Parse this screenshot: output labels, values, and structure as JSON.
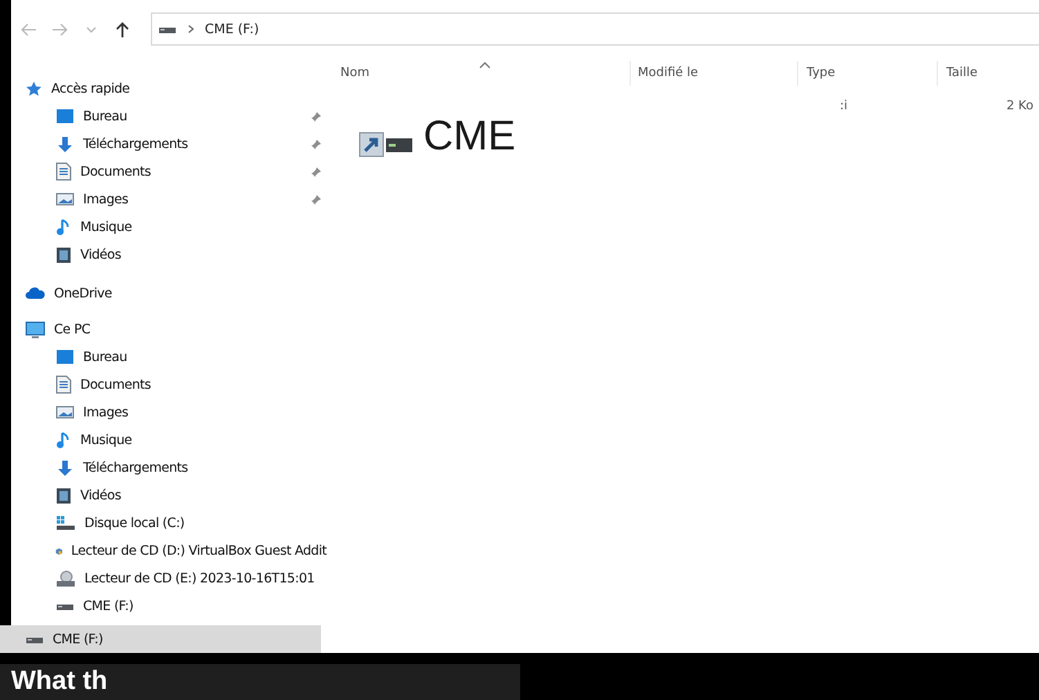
{
  "navigation": {
    "buttons": [
      {
        "kind": "back",
        "disabled": true
      },
      {
        "kind": "forward",
        "disabled": true
      },
      {
        "kind": "recent",
        "disabled": true
      },
      {
        "kind": "up",
        "disabled": false
      }
    ],
    "address": {
      "kind": "drive",
      "path": [
        "CME (F:)"
      ]
    }
  },
  "sidebar": {
    "items": [
      {
        "label": "Accès rapide",
        "kind": "star",
        "selected": false,
        "children": [
          {
            "label": "Bureau",
            "kind": "desktop",
            "pinned": true,
            "selected": false
          },
          {
            "label": "Téléchargements",
            "kind": "download",
            "pinned": true,
            "selected": false
          },
          {
            "label": "Documents",
            "kind": "document",
            "pinned": true,
            "selected": false
          },
          {
            "label": "Images",
            "kind": "picture",
            "pinned": true,
            "selected": false
          },
          {
            "label": "Musique",
            "kind": "music",
            "pinned": false,
            "selected": false
          },
          {
            "label": "Vidéos",
            "kind": "video",
            "pinned": false,
            "selected": false
          }
        ]
      },
      {
        "label": "OneDrive",
        "kind": "cloud",
        "selected": false
      },
      {
        "label": "Ce PC",
        "kind": "pc",
        "selected": false,
        "children": [
          {
            "label": "Bureau",
            "kind": "desktop",
            "selected": false
          },
          {
            "label": "Documents",
            "kind": "document",
            "selected": false
          },
          {
            "label": "Images",
            "kind": "picture",
            "selected": false
          },
          {
            "label": "Musique",
            "kind": "music",
            "selected": false
          },
          {
            "label": "Téléchargements",
            "kind": "download",
            "selected": false
          },
          {
            "label": "Vidéos",
            "kind": "video",
            "selected": false
          },
          {
            "label": "Disque local (C:)",
            "kind": "localdisk",
            "selected": false
          },
          {
            "label": "Lecteur de CD (D:) VirtualBox Guest Addit",
            "kind": "cdbox",
            "selected": false
          },
          {
            "label": "Lecteur de CD (E:) 2023-10-16T15:01",
            "kind": "cd",
            "selected": false
          },
          {
            "label": "CME (F:)",
            "kind": "drive",
            "selected": false
          }
        ]
      },
      {
        "label": "CME (F:)",
        "kind": "drive",
        "selected": true
      }
    ]
  },
  "file_list": {
    "columns": [
      {
        "label": "Nom",
        "sorted": true
      },
      {
        "label": "Modifié le",
        "sorted": false
      },
      {
        "label": "Type",
        "sorted": false
      },
      {
        "label": "Taille",
        "sorted": false
      }
    ],
    "rows": [
      {
        "cells": [
          "",
          "",
          ":i",
          "2 Ko"
        ]
      }
    ],
    "enlarged_item": {
      "kind": "shortcut-drive",
      "label": "CME"
    }
  },
  "banner": {
    "text": "What th"
  }
}
